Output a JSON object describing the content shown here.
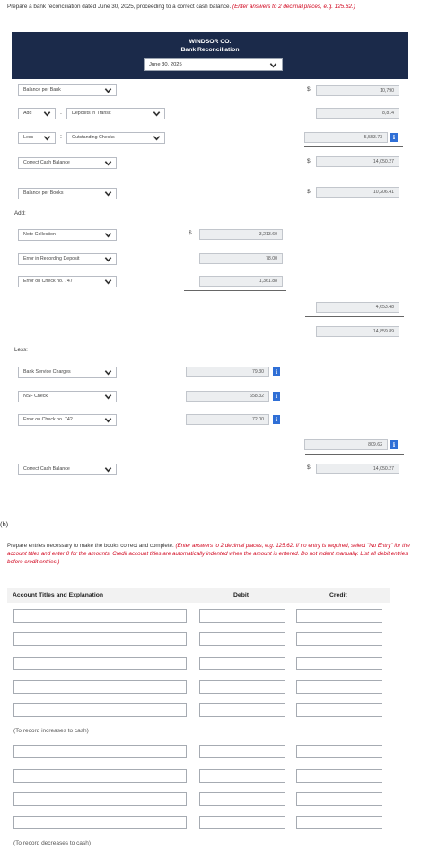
{
  "intro": {
    "text": "Prepare a bank reconciliation dated June 30, 2025, proceeding to a correct cash balance.",
    "red": "(Enter answers to 2 decimal places, e.g. 125.62.)"
  },
  "header": {
    "company": "WINDSOR CO.",
    "subtitle": "Bank Reconciliation",
    "date": "June 30, 2025"
  },
  "recon": {
    "balance_per_bank": "Balance per Bank",
    "add_op": "Add",
    "deposits_in_transit": "Deposits in Transit",
    "less_op": "Less",
    "outstanding_checks": "Outstanding Checks",
    "correct_cash_balance": "Correct Cash Balance",
    "balance_per_books": "Balance per Books",
    "add_heading": "Add:",
    "note_collection": "Note Collection",
    "error_recording_deposit": "Error in Recording Deposit",
    "error_check_747": "Error on Check no. 747",
    "less_heading": "Less:",
    "bank_service_charges": "Bank Service Charges",
    "nsf_check": "NSF Check",
    "error_check_742": "Error on Check no. 742",
    "correct_cash_balance_2": "Correct Cash Balance",
    "dollar": "$",
    "colon": ":",
    "amounts": {
      "bank_balance": "10,790",
      "deposits": "8,814",
      "outstanding": "5,553.73",
      "correct_bank": "14,050.27",
      "books_balance": "10,206.41",
      "note": "3,213.60",
      "error_deposit": "78.00",
      "error_747": "1,361.88",
      "add_total": "4,653.48",
      "subtotal": "14,859.89",
      "service": "79.30",
      "nsf": "658.32",
      "error_742": "72.00",
      "less_total": "809.62",
      "correct_books": "14,050.27"
    },
    "info_icon": "i"
  },
  "part_b": {
    "label": "(b)",
    "text": "Prepare entries necessary to make the books correct and complete.",
    "red": "(Enter answers to 2 decimal places, e.g. 125.62. If no entry is required, select \"No Entry\" for the account titles and enter 0 for the amounts. Credit account titles are automatically indented when the amount is entered. Do not indent manually. List all debit entries before credit entries.)",
    "col_account": "Account Titles and Explanation",
    "col_debit": "Debit",
    "col_credit": "Credit",
    "note_increases": "(To record increases to cash)",
    "note_decreases": "(To record decreases to cash)"
  },
  "colors": {
    "header_bg": "#1b2a4a",
    "info": "#2f6fd6",
    "red_text": "#d0021b"
  }
}
